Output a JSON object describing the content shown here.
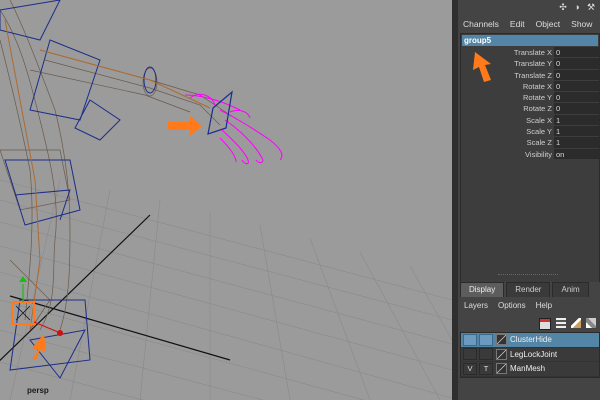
{
  "viewport": {
    "camera_label": "persp"
  },
  "toolbar_icons": [
    "axis-icon",
    "sphere-icon",
    "wrench-icon"
  ],
  "channel_box": {
    "menu": [
      "Channels",
      "Edit",
      "Object",
      "Show"
    ],
    "object_name": "group5",
    "attributes": [
      {
        "name": "Translate X",
        "value": "0"
      },
      {
        "name": "Translate Y",
        "value": "0"
      },
      {
        "name": "Translate Z",
        "value": "0"
      },
      {
        "name": "Rotate X",
        "value": "0"
      },
      {
        "name": "Rotate Y",
        "value": "0"
      },
      {
        "name": "Rotate Z",
        "value": "0"
      },
      {
        "name": "Scale X",
        "value": "1"
      },
      {
        "name": "Scale Y",
        "value": "1"
      },
      {
        "name": "Scale Z",
        "value": "1"
      },
      {
        "name": "Visibility",
        "value": "on"
      }
    ]
  },
  "layer_editor": {
    "tabs": [
      "Display",
      "Render",
      "Anim"
    ],
    "active_tab": "Display",
    "menu": [
      "Layers",
      "Options",
      "Help"
    ],
    "layers": [
      {
        "name": "ClusterHide",
        "v": "",
        "t": "",
        "selected": true
      },
      {
        "name": "LegLockJoint",
        "v": "",
        "t": "",
        "selected": false
      },
      {
        "name": "ManMesh",
        "v": "V",
        "t": "T",
        "selected": false
      }
    ]
  },
  "colors": {
    "accent": "#5285a6",
    "viewport_bg": "#9b9b9b",
    "annotation": "#ff7a1a",
    "selection": "#ff00ff"
  }
}
